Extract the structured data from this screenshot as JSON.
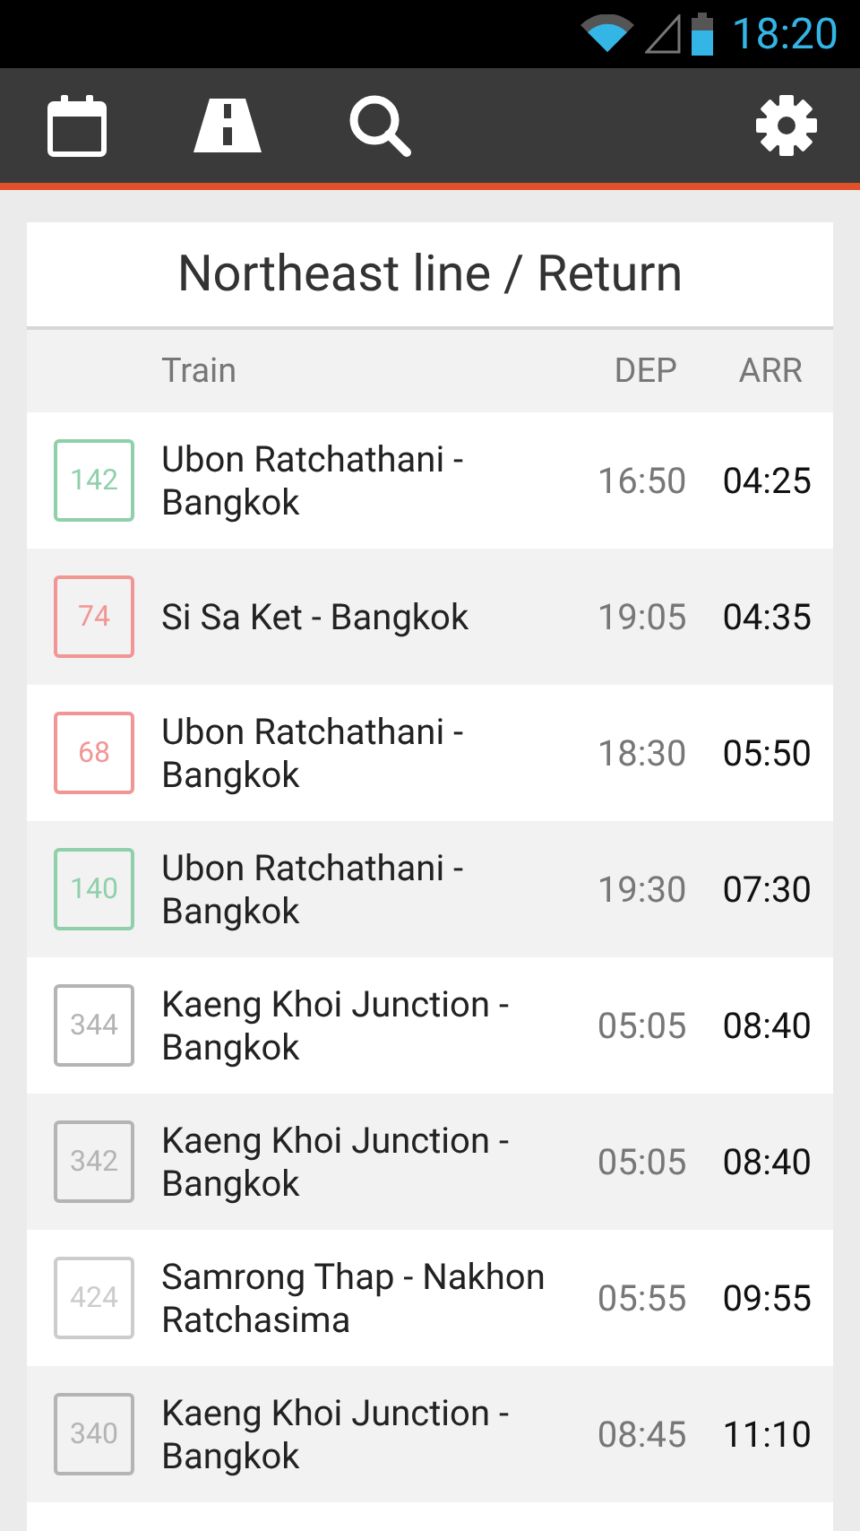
{
  "status_bar": {
    "time": "18:20"
  },
  "title": "Northeast line / Return",
  "columns": {
    "train": "Train",
    "dep": "DEP",
    "arr": "ARR"
  },
  "trains": [
    {
      "number": "142",
      "color": "#8fd0ab",
      "route": "Ubon Ratchathani - Bangkok",
      "dep": "16:50",
      "arr": "04:25"
    },
    {
      "number": "74",
      "color": "#f29595",
      "route": "Si Sa Ket - Bangkok",
      "dep": "19:05",
      "arr": "04:35"
    },
    {
      "number": "68",
      "color": "#f29595",
      "route": "Ubon Ratchathani - Bangkok",
      "dep": "18:30",
      "arr": "05:50"
    },
    {
      "number": "140",
      "color": "#8fd0ab",
      "route": "Ubon Ratchathani - Bangkok",
      "dep": "19:30",
      "arr": "07:30"
    },
    {
      "number": "344",
      "color": "#b4b4b4",
      "route": "Kaeng Khoi Junction - Bangkok",
      "dep": "05:05",
      "arr": "08:40"
    },
    {
      "number": "342",
      "color": "#b4b4b4",
      "route": "Kaeng Khoi Junction - Bangkok",
      "dep": "05:05",
      "arr": "08:40"
    },
    {
      "number": "424",
      "color": "#cccccc",
      "route": "Samrong Thap - Nakhon Ratchasima",
      "dep": "05:55",
      "arr": "09:55"
    },
    {
      "number": "340",
      "color": "#b4b4b4",
      "route": "Kaeng Khoi Junction - Bangkok",
      "dep": "08:45",
      "arr": "11:10"
    }
  ]
}
